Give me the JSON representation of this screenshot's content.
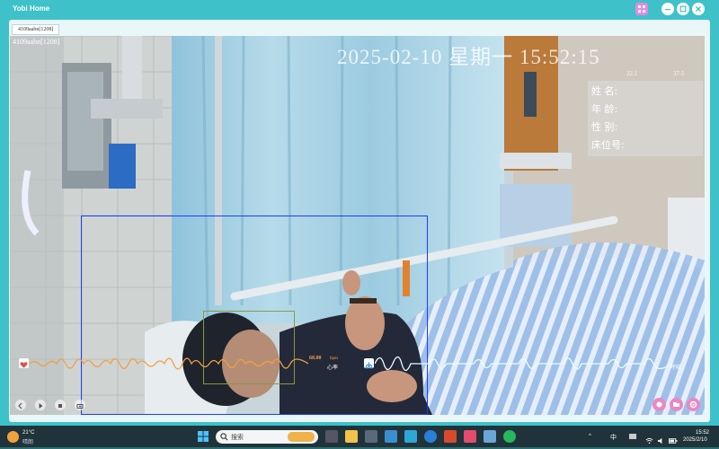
{
  "window": {
    "title": "Yobi Home"
  },
  "tab": {
    "label": "4109aabn[1208]"
  },
  "video": {
    "camera_label": "4109aabn[1208]",
    "timestamp": "2025-02-10 星期一 15:52:15",
    "sensor_1": "22.1",
    "sensor_2": "37.5",
    "patient_info": {
      "name_label": "姓 名:",
      "age_label": "年 龄:",
      "gender_label": "性 别:",
      "bed_label": "床位号:"
    },
    "heart_rate_value": "68.00",
    "heart_rate_unit": "bpm",
    "heart_rate_label": "心率",
    "resp_label": "呼吸"
  },
  "taskbar": {
    "weather_temp": "21°C",
    "weather_desc": "晴朗",
    "search_placeholder": "搜索",
    "ime": "中",
    "clock_time": "15:52",
    "clock_date": "2025/2/10"
  },
  "colors": {
    "titlebar": "#3fc1c9",
    "detection_box": "#1a3cff",
    "hr_wave": "#f0a040",
    "resp_wave": "#e8ffff"
  }
}
